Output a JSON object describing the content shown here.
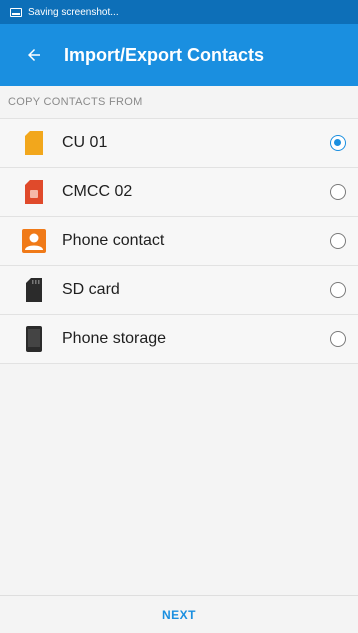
{
  "status_bar": {
    "text": "Saving screenshot..."
  },
  "app_bar": {
    "title": "Import/Export Contacts"
  },
  "section": {
    "header": "COPY CONTACTS FROM"
  },
  "items": [
    {
      "label": "CU 01",
      "icon": "sim-card-icon",
      "color": "#f2a71c",
      "selected": true
    },
    {
      "label": "CMCC 02",
      "icon": "sim-card-icon",
      "color": "#e04a2b",
      "selected": false
    },
    {
      "label": "Phone contact",
      "icon": "contact-card-icon",
      "color": "#f07a18",
      "selected": false
    },
    {
      "label": "SD card",
      "icon": "sd-card-icon",
      "color": "#2b2b2b",
      "selected": false
    },
    {
      "label": "Phone storage",
      "icon": "phone-icon",
      "color": "#2b2b2b",
      "selected": false
    }
  ],
  "footer": {
    "next_label": "NEXT"
  },
  "colors": {
    "status_bar": "#0d6fb8",
    "app_bar": "#1a8fe0",
    "accent": "#1a8fe0"
  }
}
